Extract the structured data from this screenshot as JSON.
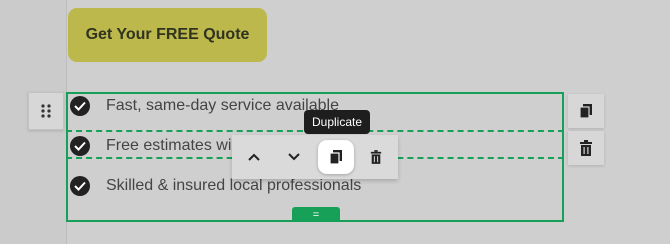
{
  "cta": {
    "label": "Get Your FREE Quote"
  },
  "list": {
    "items": [
      {
        "text": "Fast, same-day service available"
      },
      {
        "text": "Free estimates wi"
      },
      {
        "text": "Skilled & insured local professionals"
      }
    ]
  },
  "tooltip": {
    "text": "Duplicate"
  },
  "resize_handle": {
    "label": "="
  },
  "icons": {
    "drag": "drag-dots-icon",
    "copy": "copy-icon",
    "trash": "trash-icon",
    "up": "chevron-up-icon",
    "down": "chevron-down-icon",
    "check": "check-circle-icon"
  },
  "colors": {
    "accent": "#16a058",
    "cta_bg": "#bdb84c",
    "tooltip_bg": "#1e1e1e"
  }
}
